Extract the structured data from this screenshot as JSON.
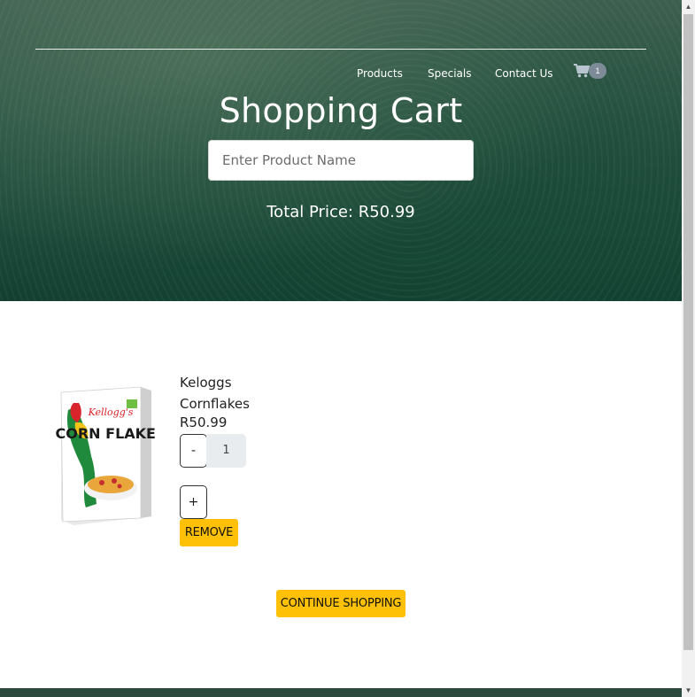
{
  "nav": {
    "items": [
      {
        "label": "Products"
      },
      {
        "label": "Specials"
      },
      {
        "label": "Contact Us"
      }
    ],
    "cart": {
      "icon": "cart-icon",
      "count": "1"
    }
  },
  "header": {
    "title": "Shopping Cart",
    "search_placeholder": "Enter Product Name",
    "total_price": "Total Price: R50.99"
  },
  "cart_items": [
    {
      "name": "Keloggs Cornflakes",
      "price": "R50.99",
      "quantity": "1",
      "minus_label": "-",
      "plus_label": "+",
      "remove_label": "REMOVE",
      "image": {
        "brand": "Kellogg's",
        "product": "CORN FLAKES"
      }
    }
  ],
  "continue_label": "CONTINUE SHOPPING",
  "colors": {
    "hero_dark": "#133f31",
    "hero_light": "#3d5f4f",
    "accent_yellow": "#ffc107",
    "badge": "#7d8a97"
  }
}
